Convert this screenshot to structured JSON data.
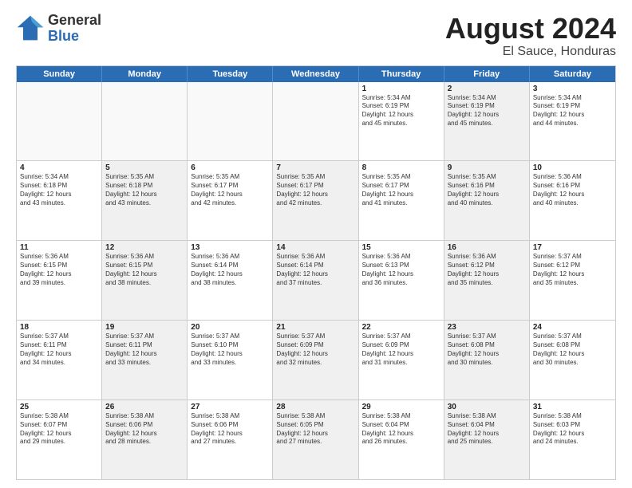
{
  "logo": {
    "general": "General",
    "blue": "Blue"
  },
  "title": {
    "month": "August 2024",
    "location": "El Sauce, Honduras"
  },
  "header_days": [
    "Sunday",
    "Monday",
    "Tuesday",
    "Wednesday",
    "Thursday",
    "Friday",
    "Saturday"
  ],
  "rows": [
    [
      {
        "day": "",
        "text": "",
        "empty": true
      },
      {
        "day": "",
        "text": "",
        "empty": true
      },
      {
        "day": "",
        "text": "",
        "empty": true
      },
      {
        "day": "",
        "text": "",
        "empty": true
      },
      {
        "day": "1",
        "text": "Sunrise: 5:34 AM\nSunset: 6:19 PM\nDaylight: 12 hours\nand 45 minutes.",
        "empty": false
      },
      {
        "day": "2",
        "text": "Sunrise: 5:34 AM\nSunset: 6:19 PM\nDaylight: 12 hours\nand 45 minutes.",
        "empty": false,
        "shaded": true
      },
      {
        "day": "3",
        "text": "Sunrise: 5:34 AM\nSunset: 6:19 PM\nDaylight: 12 hours\nand 44 minutes.",
        "empty": false
      }
    ],
    [
      {
        "day": "4",
        "text": "Sunrise: 5:34 AM\nSunset: 6:18 PM\nDaylight: 12 hours\nand 43 minutes.",
        "empty": false
      },
      {
        "day": "5",
        "text": "Sunrise: 5:35 AM\nSunset: 6:18 PM\nDaylight: 12 hours\nand 43 minutes.",
        "empty": false,
        "shaded": true
      },
      {
        "day": "6",
        "text": "Sunrise: 5:35 AM\nSunset: 6:17 PM\nDaylight: 12 hours\nand 42 minutes.",
        "empty": false
      },
      {
        "day": "7",
        "text": "Sunrise: 5:35 AM\nSunset: 6:17 PM\nDaylight: 12 hours\nand 42 minutes.",
        "empty": false,
        "shaded": true
      },
      {
        "day": "8",
        "text": "Sunrise: 5:35 AM\nSunset: 6:17 PM\nDaylight: 12 hours\nand 41 minutes.",
        "empty": false
      },
      {
        "day": "9",
        "text": "Sunrise: 5:35 AM\nSunset: 6:16 PM\nDaylight: 12 hours\nand 40 minutes.",
        "empty": false,
        "shaded": true
      },
      {
        "day": "10",
        "text": "Sunrise: 5:36 AM\nSunset: 6:16 PM\nDaylight: 12 hours\nand 40 minutes.",
        "empty": false
      }
    ],
    [
      {
        "day": "11",
        "text": "Sunrise: 5:36 AM\nSunset: 6:15 PM\nDaylight: 12 hours\nand 39 minutes.",
        "empty": false
      },
      {
        "day": "12",
        "text": "Sunrise: 5:36 AM\nSunset: 6:15 PM\nDaylight: 12 hours\nand 38 minutes.",
        "empty": false,
        "shaded": true
      },
      {
        "day": "13",
        "text": "Sunrise: 5:36 AM\nSunset: 6:14 PM\nDaylight: 12 hours\nand 38 minutes.",
        "empty": false
      },
      {
        "day": "14",
        "text": "Sunrise: 5:36 AM\nSunset: 6:14 PM\nDaylight: 12 hours\nand 37 minutes.",
        "empty": false,
        "shaded": true
      },
      {
        "day": "15",
        "text": "Sunrise: 5:36 AM\nSunset: 6:13 PM\nDaylight: 12 hours\nand 36 minutes.",
        "empty": false
      },
      {
        "day": "16",
        "text": "Sunrise: 5:36 AM\nSunset: 6:12 PM\nDaylight: 12 hours\nand 35 minutes.",
        "empty": false,
        "shaded": true
      },
      {
        "day": "17",
        "text": "Sunrise: 5:37 AM\nSunset: 6:12 PM\nDaylight: 12 hours\nand 35 minutes.",
        "empty": false
      }
    ],
    [
      {
        "day": "18",
        "text": "Sunrise: 5:37 AM\nSunset: 6:11 PM\nDaylight: 12 hours\nand 34 minutes.",
        "empty": false
      },
      {
        "day": "19",
        "text": "Sunrise: 5:37 AM\nSunset: 6:11 PM\nDaylight: 12 hours\nand 33 minutes.",
        "empty": false,
        "shaded": true
      },
      {
        "day": "20",
        "text": "Sunrise: 5:37 AM\nSunset: 6:10 PM\nDaylight: 12 hours\nand 33 minutes.",
        "empty": false
      },
      {
        "day": "21",
        "text": "Sunrise: 5:37 AM\nSunset: 6:09 PM\nDaylight: 12 hours\nand 32 minutes.",
        "empty": false,
        "shaded": true
      },
      {
        "day": "22",
        "text": "Sunrise: 5:37 AM\nSunset: 6:09 PM\nDaylight: 12 hours\nand 31 minutes.",
        "empty": false
      },
      {
        "day": "23",
        "text": "Sunrise: 5:37 AM\nSunset: 6:08 PM\nDaylight: 12 hours\nand 30 minutes.",
        "empty": false,
        "shaded": true
      },
      {
        "day": "24",
        "text": "Sunrise: 5:37 AM\nSunset: 6:08 PM\nDaylight: 12 hours\nand 30 minutes.",
        "empty": false
      }
    ],
    [
      {
        "day": "25",
        "text": "Sunrise: 5:38 AM\nSunset: 6:07 PM\nDaylight: 12 hours\nand 29 minutes.",
        "empty": false
      },
      {
        "day": "26",
        "text": "Sunrise: 5:38 AM\nSunset: 6:06 PM\nDaylight: 12 hours\nand 28 minutes.",
        "empty": false,
        "shaded": true
      },
      {
        "day": "27",
        "text": "Sunrise: 5:38 AM\nSunset: 6:06 PM\nDaylight: 12 hours\nand 27 minutes.",
        "empty": false
      },
      {
        "day": "28",
        "text": "Sunrise: 5:38 AM\nSunset: 6:05 PM\nDaylight: 12 hours\nand 27 minutes.",
        "empty": false,
        "shaded": true
      },
      {
        "day": "29",
        "text": "Sunrise: 5:38 AM\nSunset: 6:04 PM\nDaylight: 12 hours\nand 26 minutes.",
        "empty": false
      },
      {
        "day": "30",
        "text": "Sunrise: 5:38 AM\nSunset: 6:04 PM\nDaylight: 12 hours\nand 25 minutes.",
        "empty": false,
        "shaded": true
      },
      {
        "day": "31",
        "text": "Sunrise: 5:38 AM\nSunset: 6:03 PM\nDaylight: 12 hours\nand 24 minutes.",
        "empty": false
      }
    ]
  ]
}
